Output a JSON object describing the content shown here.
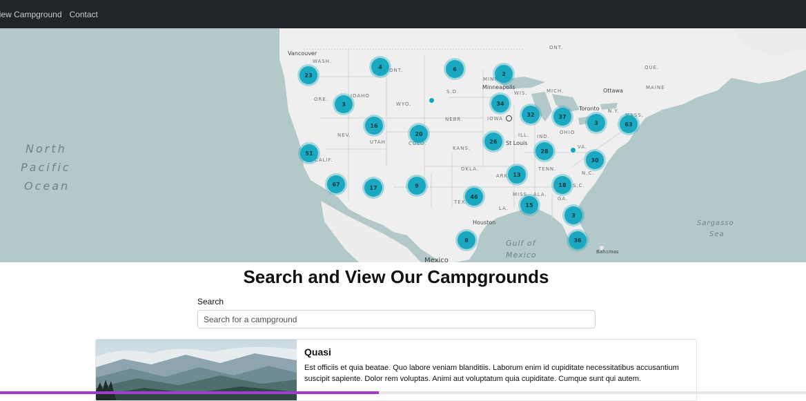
{
  "nav": {
    "items": [
      "View Campground",
      "Contact"
    ]
  },
  "map": {
    "oceans": [
      "North",
      "Pacific",
      "Ocean"
    ],
    "gulf": [
      "Gulf of",
      "Mexico"
    ],
    "sargasso": [
      "Sargasso",
      "Sea"
    ],
    "place_labels": [
      "ONT.",
      "WASH.",
      "MONT.",
      "IDAHO",
      "ORE.",
      "WYO.",
      "S.D.",
      "NEBR.",
      "NEV.",
      "UTAH",
      "COLO.",
      "KANS.",
      "CALIF.",
      "OKLA.",
      "ARK.",
      "TEX.",
      "LA.",
      "MISS.",
      "ALA.",
      "GA.",
      "TENN.",
      "N.C.",
      "S.C.",
      "VA.",
      "OHIO",
      "IND.",
      "ILL.",
      "IOWA",
      "MINN.",
      "WIS.",
      "MICH.",
      "N.Y.",
      "MAINE",
      "MASS.",
      "QUE."
    ],
    "city_labels": [
      "Vancouver",
      "Minneapolis",
      "Ottawa",
      "Toronto",
      "St Louis",
      "Houston",
      "Mexico",
      "Bahamas"
    ],
    "clusters": [
      {
        "count": "23"
      },
      {
        "count": "4"
      },
      {
        "count": "6"
      },
      {
        "count": "2"
      },
      {
        "count": "3"
      },
      {
        "count": "34"
      },
      {
        "count": "32"
      },
      {
        "count": "37"
      },
      {
        "count": "3"
      },
      {
        "count": "63"
      },
      {
        "count": "16"
      },
      {
        "count": "20"
      },
      {
        "count": "26"
      },
      {
        "count": "28"
      },
      {
        "count": "51"
      },
      {
        "count": "30"
      },
      {
        "count": "13"
      },
      {
        "count": "67"
      },
      {
        "count": "17"
      },
      {
        "count": "9"
      },
      {
        "count": "46"
      },
      {
        "count": "18"
      },
      {
        "count": "15"
      },
      {
        "count": "3"
      },
      {
        "count": "8"
      },
      {
        "count": "36"
      }
    ],
    "colors": {
      "water": "#b3c8c8",
      "land": "#efefef",
      "cluster": "#1aa9c0"
    }
  },
  "page": {
    "title": "Search and View Our Campgrounds"
  },
  "search": {
    "label": "Search",
    "placeholder": "Search for a campground",
    "value": ""
  },
  "campgrounds": [
    {
      "title": "Quasi",
      "description": "Est officiis et quia beatae. Quo labore veniam blanditiis. Laborum enim id cupiditate necessitatibus accusantium suscipit sapiente. Dolor rem voluptas. Animi aut voluptatum quia cupiditate. Cumque sunt qui autem."
    }
  ],
  "video_progress": 0.47
}
